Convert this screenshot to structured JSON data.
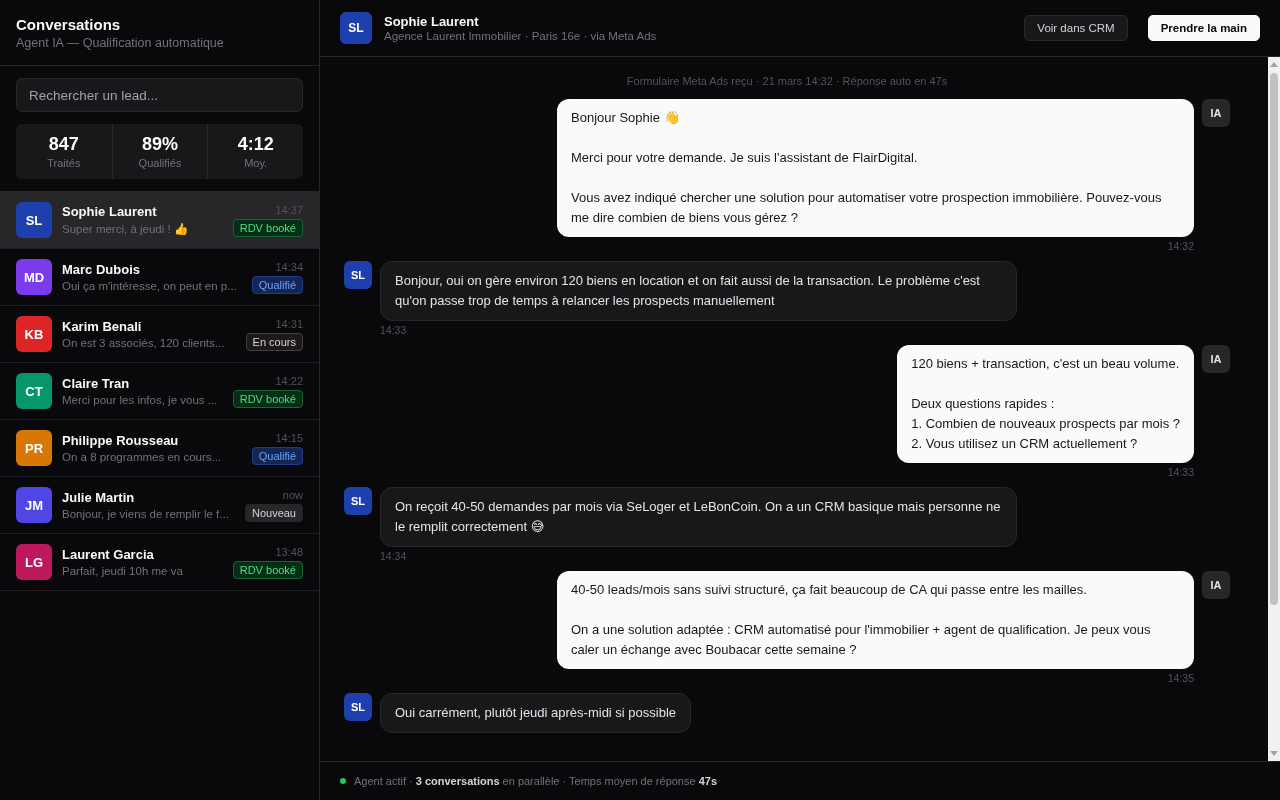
{
  "sidebar": {
    "title": "Conversations",
    "subtitle": "Agent IA — Qualification automatique",
    "search": {
      "placeholder": "Rechercher un lead..."
    },
    "stats": [
      {
        "value": "847",
        "label": "Traités"
      },
      {
        "value": "89%",
        "label": "Qualifiés"
      },
      {
        "value": "4:12",
        "label": "Moy."
      }
    ],
    "conversations": [
      {
        "initials": "SL",
        "color": "#1e40af",
        "name": "Sophie Laurent",
        "preview": "Super merci, à jeudi ! 👍",
        "time": "14:37",
        "tag": "RDV booké",
        "kind": "booked",
        "selected": true
      },
      {
        "initials": "MD",
        "color": "#7c3aed",
        "name": "Marc Dubois",
        "preview": "Oui ça m'intéresse, on peut en p...",
        "time": "14:34",
        "tag": "Qualifié",
        "kind": "qualified",
        "selected": false
      },
      {
        "initials": "KB",
        "color": "#dc2626",
        "name": "Karim Benali",
        "preview": "On est 3 associés, 120 clients...",
        "time": "14:31",
        "tag": "En cours",
        "kind": "progress",
        "selected": false
      },
      {
        "initials": "CT",
        "color": "#059669",
        "name": "Claire Tran",
        "preview": "Merci pour les infos, je vous ...",
        "time": "14:22",
        "tag": "RDV booké",
        "kind": "booked",
        "selected": false
      },
      {
        "initials": "PR",
        "color": "#d97706",
        "name": "Philippe Rousseau",
        "preview": "On a 8 programmes en cours...",
        "time": "14:15",
        "tag": "Qualifié",
        "kind": "qualified",
        "selected": false
      },
      {
        "initials": "JM",
        "color": "#4f46e5",
        "name": "Julie Martin",
        "preview": "Bonjour, je viens de remplir le f...",
        "time": "now",
        "tag": "Nouveau",
        "kind": "new",
        "selected": false
      },
      {
        "initials": "LG",
        "color": "#be185d",
        "name": "Laurent Garcia",
        "preview": "Parfait, jeudi 10h me va",
        "time": "13:48",
        "tag": "RDV booké",
        "kind": "booked",
        "selected": false
      }
    ]
  },
  "chat": {
    "header": {
      "initials": "SL",
      "color": "#1e40af",
      "name": "Sophie Laurent",
      "subtitle": "Agence Laurent Immobilier · Paris 16e · via Meta Ads",
      "buttons": [
        {
          "label": "Voir dans CRM",
          "kind": "secondary"
        },
        {
          "label": "Prendre la main",
          "kind": "primary"
        }
      ]
    },
    "system_note": "Formulaire Meta Ads reçu · 21 mars 14:32 · Réponse auto en 47s",
    "messages": [
      {
        "kind": "ai",
        "avatar": "IA",
        "paragraphs": [
          [
            "Bonjour Sophie 👋"
          ],
          [
            "Merci pour votre demande. Je suis l'assistant de FlairDigital."
          ],
          [
            "Vous avez indiqué chercher une solution pour automatiser votre prospection immobilière. Pouvez-vous me dire combien de biens vous gérez ?"
          ]
        ],
        "time": "14:32"
      },
      {
        "kind": "lead",
        "avatar": "SL",
        "paragraphs": [
          [
            "Bonjour, oui on gère environ 120 biens en location et on fait aussi de la transaction. Le problème c'est qu'on passe trop de temps à relancer les prospects manuellement"
          ]
        ],
        "time": "14:33"
      },
      {
        "kind": "ai",
        "avatar": "IA",
        "paragraphs": [
          [
            "120 biens + transaction, c'est un beau volume."
          ],
          [
            "Deux questions rapides :",
            "1. Combien de nouveaux prospects par mois ?",
            "2. Vous utilisez un CRM actuellement ?"
          ]
        ],
        "time": "14:33"
      },
      {
        "kind": "lead",
        "avatar": "SL",
        "paragraphs": [
          [
            "On reçoit 40-50 demandes par mois via SeLoger et LeBonCoin. On a un CRM basique mais personne ne le remplit correctement 😅"
          ]
        ],
        "time": "14:34"
      },
      {
        "kind": "ai",
        "avatar": "IA",
        "paragraphs": [
          [
            "40-50 leads/mois sans suivi structuré, ça fait beaucoup de CA qui passe entre les mailles."
          ],
          [
            "On a une solution adaptée : CRM automatisé pour l'immobilier + agent de qualification. Je peux vous caler un échange avec Boubacar cette semaine ?"
          ]
        ],
        "time": "14:35"
      },
      {
        "kind": "lead",
        "avatar": "SL",
        "paragraphs": [
          [
            "Oui carrément, plutôt jeudi après-midi si possible"
          ]
        ]
      }
    ],
    "status": {
      "active": true,
      "text": "Agent actif · **3 conversations** en parallèle · Temps moyen de réponse **47s**"
    }
  }
}
